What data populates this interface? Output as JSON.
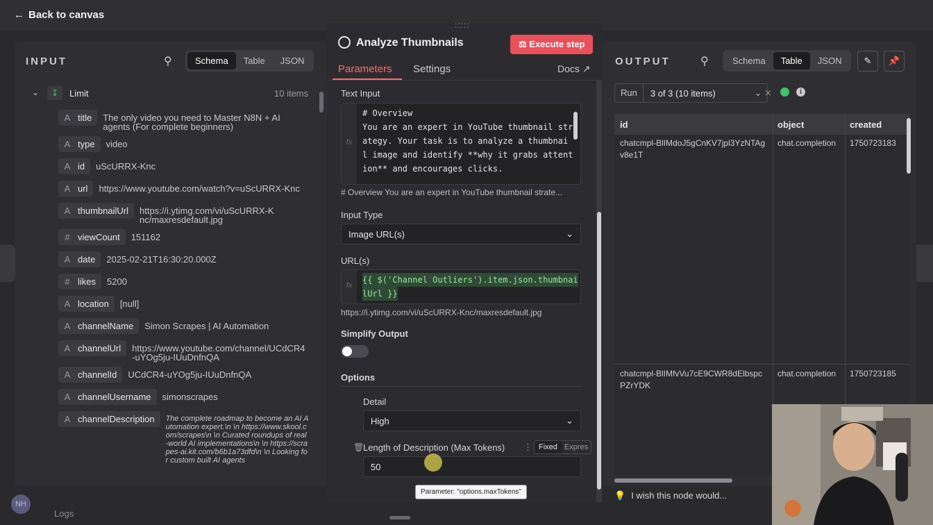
{
  "nav": {
    "back_label": "Back to canvas",
    "logs_label": "Logs",
    "avatar_initials": "NH"
  },
  "input_panel": {
    "title": "INPUT",
    "view_tabs": [
      "Schema",
      "Table",
      "JSON"
    ],
    "active_tab": "Schema",
    "node_name": "Limit",
    "item_count": "10 items",
    "fields": [
      {
        "type": "A",
        "key": "title",
        "value": "The only video you need to Master N8N + AI agents (For complete beginners)"
      },
      {
        "type": "A",
        "key": "type",
        "value": "video"
      },
      {
        "type": "A",
        "key": "id",
        "value": "uScURRX-Knc"
      },
      {
        "type": "A",
        "key": "url",
        "value": "https://www.youtube.com/watch?v=uScURRX-Knc"
      },
      {
        "type": "A",
        "key": "thumbnailUrl",
        "value": "https://i.ytimg.com/vi/uScURRX-Knc/maxresdefault.jpg"
      },
      {
        "type": "#",
        "key": "viewCount",
        "value": "151162"
      },
      {
        "type": "A",
        "key": "date",
        "value": "2025-02-21T16:30:20.000Z"
      },
      {
        "type": "#",
        "key": "likes",
        "value": "5200"
      },
      {
        "type": "A",
        "key": "location",
        "value": "[null]"
      },
      {
        "type": "A",
        "key": "channelName",
        "value": "Simon Scrapes | AI Automation"
      },
      {
        "type": "A",
        "key": "channelUrl",
        "value": "https://www.youtube.com/channel/UCdCR4-uYOg5ju-IUuDnfnQA"
      },
      {
        "type": "A",
        "key": "channelId",
        "value": "UCdCR4-uYOg5ju-IUuDnfnQA"
      },
      {
        "type": "A",
        "key": "channelUsername",
        "value": "simonscrapes"
      },
      {
        "type": "A",
        "key": "channelDescription",
        "value": "The complete roadmap to become an AI Automation expert.\\n \\n https://www.skool.com/scrapes\\n \\n Curated roundups of real-world AI implementations\\n \\n https://scrapes-ai.kit.com/b6b1a73dfd\\n \\n Looking for custom built AI agents"
      }
    ]
  },
  "node": {
    "title": "Analyze Thumbnails",
    "execute_label": "Execute step",
    "tabs": [
      "Parameters",
      "Settings"
    ],
    "docs_label": "Docs",
    "text_input_label": "Text Input",
    "text_input_lines": [
      "# Overview",
      "You are an expert in YouTube thumbnail str",
      "ategy. Your task is to analyze a thumbnai",
      "l image and identify **why it grabs attent",
      "ion** and encourages clicks."
    ],
    "text_input_preview": "# Overview You are an expert in YouTube thumbnail strate...",
    "input_type_label": "Input Type",
    "input_type_value": "Image URL(s)",
    "urls_label": "URL(s)",
    "urls_lines": [
      "{{ $('Channel Outliers').item.json.thumbnai",
      "lUrl }}"
    ],
    "urls_preview": "https://i.ytimg.com/vi/uScURRX-Knc/maxresdefault.jpg",
    "simplify_label": "Simplify Output",
    "options_label": "Options",
    "detail_label": "Detail",
    "detail_value": "High",
    "max_tokens_label": "Length of Description (Max Tokens)",
    "fixed_label": "Fixed",
    "expression_label": "Expres",
    "max_tokens_value": "50",
    "tooltip": "Parameter: \"options.maxTokens\""
  },
  "output_panel": {
    "title": "OUTPUT",
    "view_tabs": [
      "Schema",
      "Table",
      "JSON"
    ],
    "active_tab": "Table",
    "run_label": "Run",
    "run_value": "3 of 3 (10 items)",
    "columns": [
      "id",
      "object",
      "created"
    ],
    "rows": [
      {
        "id": "chatcmpl-BlIMdoJ5gCnKV7jpl3YzNTAgv8e1T",
        "object": "chat.completion",
        "created": "1750723183"
      },
      {
        "id": "chatcmpl-BlIMfvVu7cE9CWR8dElbspcPZrYDK",
        "object": "chat.completion",
        "created": "1750723185"
      }
    ],
    "feedback": "I wish this node would..."
  },
  "colors": {
    "accent": "#e9505a",
    "success": "#3cc36b",
    "code_green": "#9be3a4"
  }
}
